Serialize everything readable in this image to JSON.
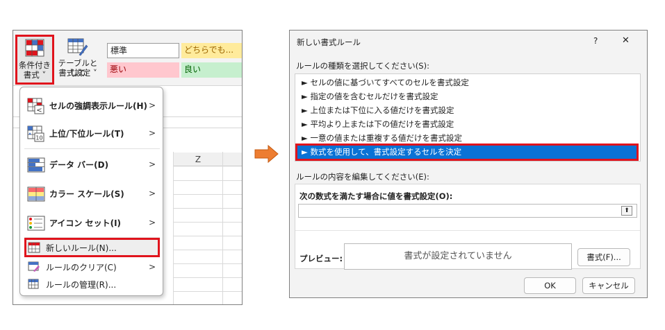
{
  "ribbon": {
    "conditional_format_label_1": "条件付き",
    "conditional_format_label_2": "書式 ˅",
    "table_format_label_1": "テーブルとして",
    "table_format_label_2": "書式設定 ˅",
    "styles": {
      "normal": "標準",
      "neutral": "どちらでも...",
      "bad": "悪い",
      "good": "良い"
    }
  },
  "sheet": {
    "column_header": "Z"
  },
  "cf_menu": {
    "items": [
      {
        "label": "セルの強調表示ルール(H)",
        "submenu": true
      },
      {
        "label": "上位/下位ルール(T)",
        "submenu": true
      },
      {
        "label": "データ バー(D)",
        "submenu": true
      },
      {
        "label": "カラー スケール(S)",
        "submenu": true
      },
      {
        "label": "アイコン セット(I)",
        "submenu": true
      },
      {
        "label": "新しいルール(N)...",
        "submenu": false
      },
      {
        "label": "ルールのクリア(C)",
        "submenu": true
      },
      {
        "label": "ルールの管理(R)...",
        "submenu": false
      }
    ],
    "icon_small_text": {
      "lt": "<",
      "ten": "10"
    },
    "chevron": ">"
  },
  "dialog": {
    "title": "新しい書式ルール",
    "help_glyph": "?",
    "close_glyph": "✕",
    "rule_type_label": "ルールの種類を選択してください(S):",
    "rule_types": [
      "► セルの値に基づいてすべてのセルを書式設定",
      "► 指定の値を含むセルだけを書式設定",
      "► 上位または下位に入る値だけを書式設定",
      "► 平均より上または下の値だけを書式設定",
      "► 一意の値または重複する値だけを書式設定",
      "► 数式を使用して、書式設定するセルを決定"
    ],
    "edit_label": "ルールの内容を編集してください(E):",
    "formula_label": "次の数式を満たす場合に値を書式設定(O):",
    "formula_value": "",
    "formula_button_glyph": "⬆",
    "preview_label": "プレビュー:",
    "preview_text": "書式が設定されていません",
    "format_button": "書式(F)...",
    "ok_button": "OK",
    "cancel_button": "キャンセル"
  },
  "colors": {
    "highlight_red": "#e0131c",
    "selection_blue": "#0a72d5",
    "arrow_orange": "#ed7d31",
    "bad_fill": "#ffc7ce",
    "good_fill": "#c6efce",
    "neutral_fill": "#ffeb9c"
  }
}
